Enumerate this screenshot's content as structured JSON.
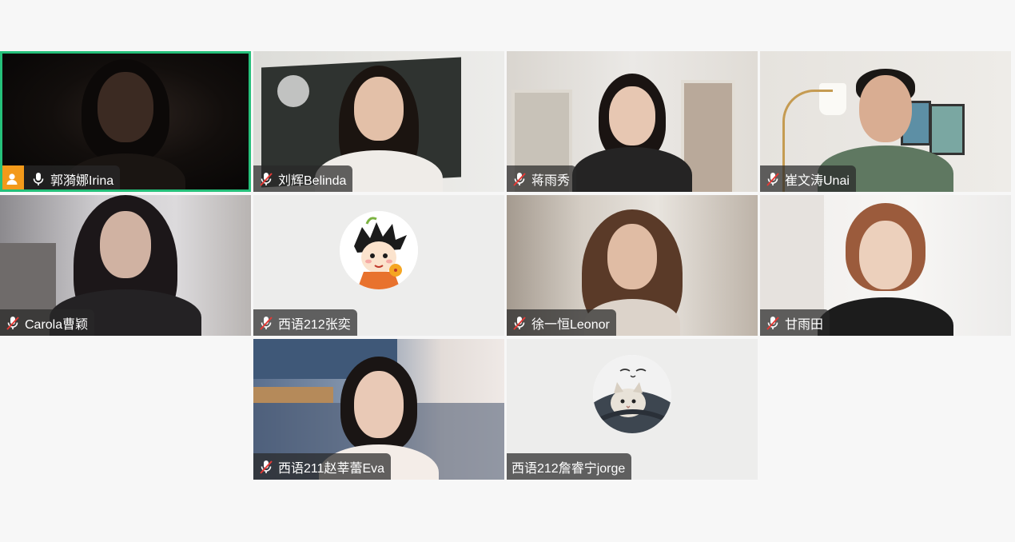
{
  "participants": [
    {
      "name": "郭漪娜Irina",
      "muted": false,
      "active_speaker": true,
      "host": true,
      "video": "camera-dark"
    },
    {
      "name": "刘辉Belinda",
      "muted": true,
      "video": "camera"
    },
    {
      "name": "蒋雨秀",
      "muted": true,
      "video": "camera"
    },
    {
      "name": "崔文涛Unai",
      "muted": true,
      "video": "camera"
    },
    {
      "name": "Carola曹颖",
      "muted": true,
      "video": "camera"
    },
    {
      "name": "西语212张奕",
      "muted": true,
      "video": "avatar",
      "avatar_icon": "cartoon-boy-avatar-icon"
    },
    {
      "name": "徐一恒Leonor",
      "muted": true,
      "video": "camera"
    },
    {
      "name": "甘雨田",
      "muted": true,
      "video": "camera"
    },
    {
      "name": "西语211赵莘蕾Eva",
      "muted": true,
      "video": "camera"
    },
    {
      "name": "西语212詹睿宁jorge",
      "muted": null,
      "video": "avatar",
      "avatar_icon": "cat-avatar-icon"
    }
  ],
  "colors": {
    "active_border": "#25c07a",
    "host_badge": "#f39a1a",
    "label_bg": "rgba(40,40,40,0.72)",
    "muted_icon": "#e53935",
    "background": "#f7f7f7"
  }
}
